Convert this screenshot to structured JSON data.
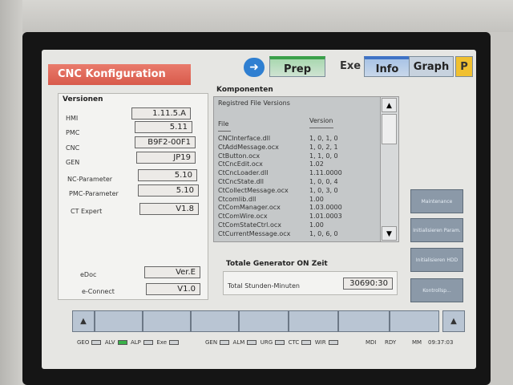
{
  "title": "CNC Konfiguration",
  "top_tabs": {
    "prep": "Prep",
    "exe": "Exe",
    "info": "Info",
    "graph": "Graph",
    "p": "P"
  },
  "versionen": {
    "header": "Versionen",
    "rows": [
      {
        "label": "HMI",
        "value": "1.11.5.A"
      },
      {
        "label": "PMC",
        "value": "5.11"
      },
      {
        "label": "CNC",
        "value": "B9F2-00F1"
      },
      {
        "label": "GEN",
        "value": "JP19"
      },
      {
        "label": "NC-Parameter",
        "value": "5.10"
      },
      {
        "label": "PMC-Parameter",
        "value": "5.10"
      },
      {
        "label": "CT Expert",
        "value": "V1.8"
      },
      {
        "label": "eDoc",
        "value": "Ver.E"
      },
      {
        "label": "e-Connect",
        "value": "V1.0"
      }
    ]
  },
  "komponenten": {
    "header": "Komponenten",
    "list_title": "Registred File Versions",
    "col_file": "File",
    "col_version": "Version",
    "rows": [
      {
        "file": "CNCInterface.dll",
        "version": "1, 0, 1, 0"
      },
      {
        "file": "CtAddMessage.ocx",
        "version": "1, 0, 2, 1"
      },
      {
        "file": "CtButton.ocx",
        "version": "1, 1, 0, 0"
      },
      {
        "file": "CtCncEdit.ocx",
        "version": "1.02"
      },
      {
        "file": "CtCncLoader.dll",
        "version": "1.11.0000"
      },
      {
        "file": "CtCncState.dll",
        "version": "1, 0, 0, 4"
      },
      {
        "file": "CtCollectMessage.ocx",
        "version": "1, 0, 3, 0"
      },
      {
        "file": "Ctcomlib.dll",
        "version": "1.00"
      },
      {
        "file": "CtComManager.ocx",
        "version": "1.03.0000"
      },
      {
        "file": "CtComWire.ocx",
        "version": "1.01.0003"
      },
      {
        "file": "CtComStateCtrl.ocx",
        "version": "1.00"
      },
      {
        "file": "CtCurrentMessage.ocx",
        "version": "1, 0, 6, 0"
      }
    ]
  },
  "generator": {
    "header": "Totale Generator ON Zeit",
    "label": "Total Stunden-Minuten",
    "value": "30690:30"
  },
  "side_buttons": [
    "Maintenance",
    "Initialisieren Param.",
    "Initialisieren HDD",
    "Kontrollsp..."
  ],
  "status": {
    "left": [
      "GEO",
      "ALV",
      "ALP",
      "Exe"
    ],
    "mid": [
      "GEN",
      "ALM",
      "URG",
      "CTC",
      "WIR"
    ],
    "mdi": "MDI",
    "rdy": "RDY",
    "mm": "MM",
    "time": "09:37:03"
  },
  "colors": {
    "title_red": "#d85a4b",
    "led_on": "#3ab24a",
    "info_blue": "#3f73c6",
    "prep_green": "#3aa04a"
  }
}
